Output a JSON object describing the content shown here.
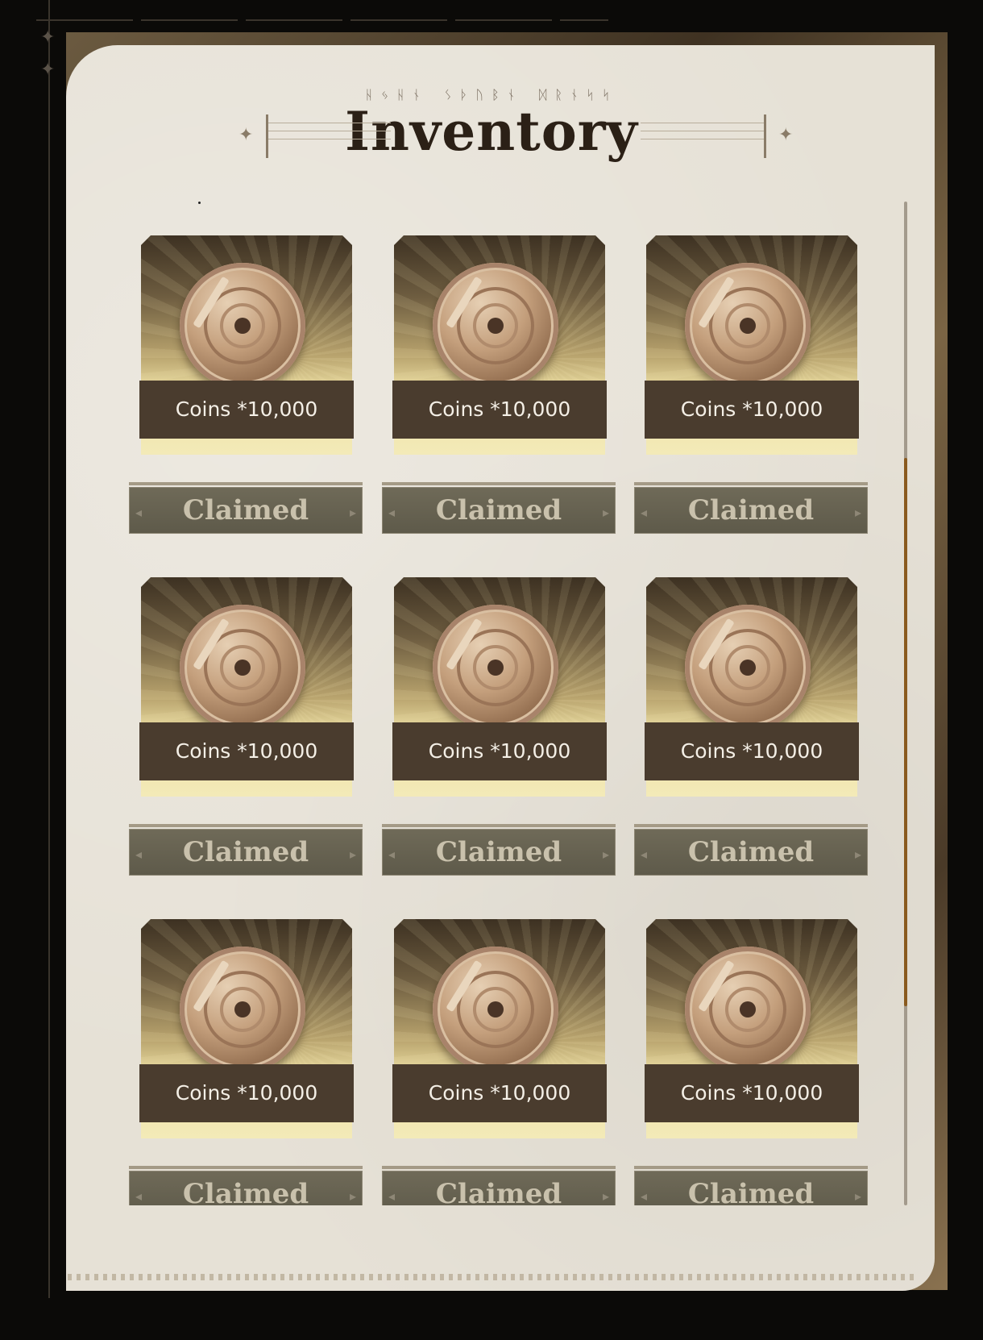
{
  "header": {
    "subtitle": "ᚺᛃᚺᚾ ᛊᚦᚢᛒᚾ ᛞᚱᚾᛋᛋ",
    "title": "Inventory"
  },
  "items": [
    {
      "label": "Coins *10,000",
      "status": "Claimed"
    },
    {
      "label": "Coins *10,000",
      "status": "Claimed"
    },
    {
      "label": "Coins *10,000",
      "status": "Claimed"
    },
    {
      "label": "Coins *10,000",
      "status": "Claimed"
    },
    {
      "label": "Coins *10,000",
      "status": "Claimed"
    },
    {
      "label": "Coins *10,000",
      "status": "Claimed"
    },
    {
      "label": "Coins *10,000",
      "status": "Claimed"
    },
    {
      "label": "Coins *10,000",
      "status": "Claimed"
    },
    {
      "label": "Coins *10,000",
      "status": "Claimed"
    }
  ],
  "icons": {
    "reward": "coin-icon",
    "decoration": "sparkle-star-icon"
  },
  "colors": {
    "panel": "#e6e1d6",
    "label_bar": "#4a3c2e",
    "button": "#6a6554",
    "scroll_thumb": "#8a5a1e",
    "title": "#2b2016"
  }
}
